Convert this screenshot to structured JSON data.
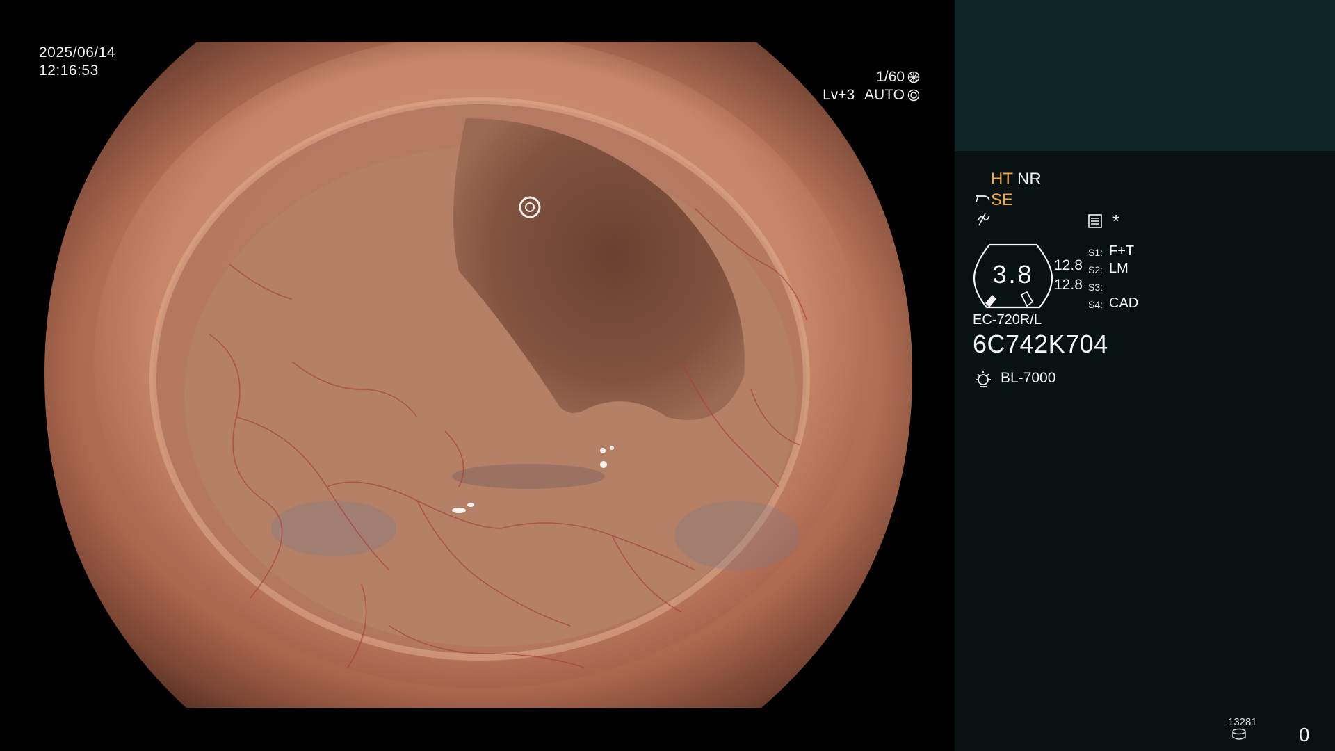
{
  "overlay": {
    "date": "2025/06/14",
    "time": "12:16:53",
    "shutter": "1/60",
    "level": "Lv+3",
    "mode": "AUTO"
  },
  "panel": {
    "ht": "HT",
    "nr": "NR",
    "se": "SE",
    "asterisk": "*",
    "gauge_value": "3.8",
    "gauge_side_1": "12.8",
    "gauge_side_2": "12.8",
    "switches": [
      {
        "label": "S1:",
        "value": "F+T"
      },
      {
        "label": "S2:",
        "value": "LM"
      },
      {
        "label": "S3:",
        "value": ""
      },
      {
        "label": "S4:",
        "value": "CAD"
      }
    ],
    "scope_model": "EC-720R/L",
    "scope_serial": "6C742K704",
    "light_source": "BL-7000",
    "image_counter": "13281",
    "count": "0"
  },
  "colors": {
    "accent_orange": "#f2a83a",
    "panel_top": "#0d2527",
    "panel_bg": "#091212"
  },
  "icons": [
    "aperture-icon",
    "iris-icon",
    "scope-tip-icon",
    "filter-icon",
    "document-icon",
    "gauge-icon",
    "light-bulb-icon",
    "storage-icon"
  ]
}
